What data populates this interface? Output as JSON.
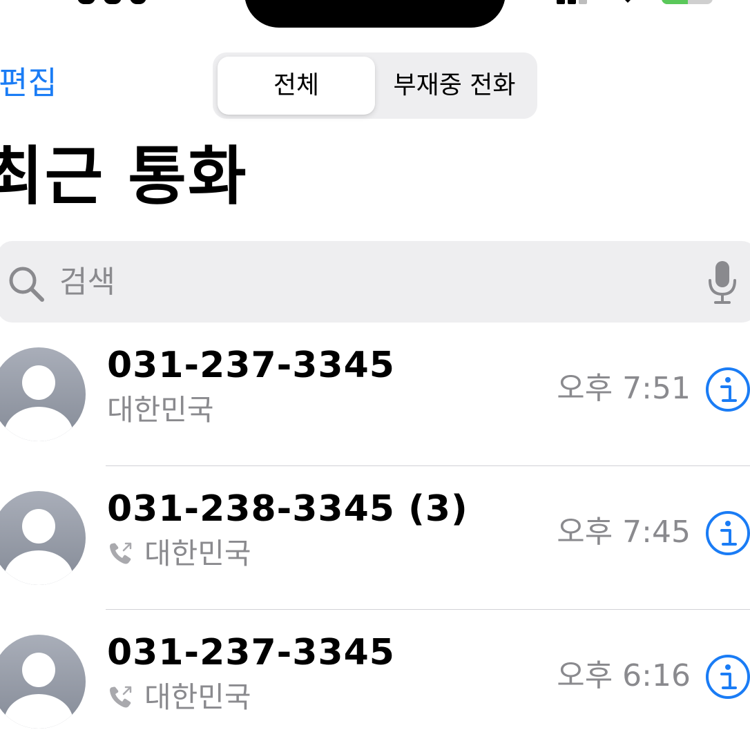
{
  "header": {
    "edit_label": "편집",
    "segments": [
      "전체",
      "부재중 전화"
    ],
    "title": "최근 통화"
  },
  "search": {
    "placeholder": "검색"
  },
  "calls": [
    {
      "number": "031-237-3345",
      "location": "대한민국",
      "time": "오후 7:51",
      "outgoing": false
    },
    {
      "number": "031-238-3345 (3)",
      "location": "대한민국",
      "time": "오후 7:45",
      "outgoing": true
    },
    {
      "number": "031-237-3345",
      "location": "대한민국",
      "time": "오후 6:16",
      "outgoing": true
    }
  ],
  "colors": {
    "accent": "#1a7cf5",
    "secondary_text": "#8a8a8e",
    "search_bg": "#eeeef0",
    "avatar_gray": "#9ea3ae"
  },
  "icons": [
    "search-icon",
    "microphone-icon",
    "outgoing-call-icon",
    "info-icon",
    "contact-avatar"
  ]
}
